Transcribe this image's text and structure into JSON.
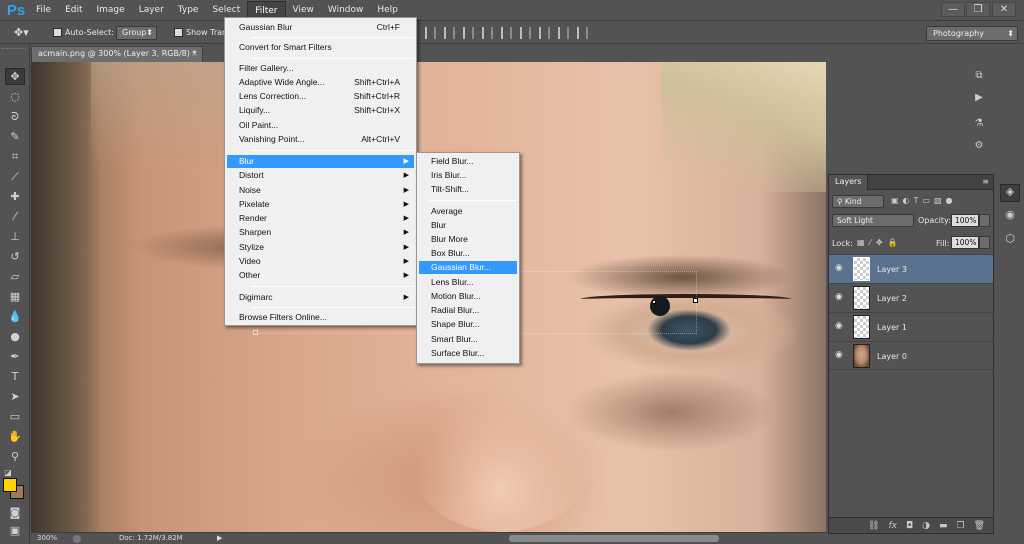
{
  "app": {
    "logo": "Ps"
  },
  "menubar": [
    "File",
    "Edit",
    "Image",
    "Layer",
    "Type",
    "Select",
    "Filter",
    "View",
    "Window",
    "Help"
  ],
  "window_controls": {
    "minimize": "—",
    "maximize": "❐",
    "close": "✕"
  },
  "options": {
    "auto_select_label": "Auto-Select:",
    "auto_select_value": "Group",
    "show_transform_label": "Show Tran"
  },
  "workspace": "Photography",
  "document": {
    "tab_title": "acmain.png @ 300% (Layer 3, RGB/8) *",
    "tab_close": "×"
  },
  "status": {
    "zoom": "300%",
    "doc_info": "Doc: 1.72M/3.82M",
    "arrow": "▶"
  },
  "filter_menu": {
    "items": [
      {
        "label": "Gaussian Blur",
        "shortcut": "Ctrl+F"
      },
      {
        "label": "Convert for Smart Filters",
        "shortcut": ""
      },
      {
        "label": "Filter Gallery...",
        "shortcut": ""
      },
      {
        "label": "Adaptive Wide Angle...",
        "shortcut": "Shift+Ctrl+A"
      },
      {
        "label": "Lens Correction...",
        "shortcut": "Shift+Ctrl+R"
      },
      {
        "label": "Liquify...",
        "shortcut": "Shift+Ctrl+X"
      },
      {
        "label": "Oil Paint...",
        "shortcut": ""
      },
      {
        "label": "Vanishing Point...",
        "shortcut": "Alt+Ctrl+V"
      },
      {
        "label": "Blur",
        "shortcut": ""
      },
      {
        "label": "Distort",
        "shortcut": ""
      },
      {
        "label": "Noise",
        "shortcut": ""
      },
      {
        "label": "Pixelate",
        "shortcut": ""
      },
      {
        "label": "Render",
        "shortcut": ""
      },
      {
        "label": "Sharpen",
        "shortcut": ""
      },
      {
        "label": "Stylize",
        "shortcut": ""
      },
      {
        "label": "Video",
        "shortcut": ""
      },
      {
        "label": "Other",
        "shortcut": ""
      },
      {
        "label": "Digimarc",
        "shortcut": ""
      },
      {
        "label": "Browse Filters Online...",
        "shortcut": ""
      }
    ],
    "submenu_arrow": "▶"
  },
  "blur_submenu": {
    "items": [
      "Field Blur...",
      "Iris Blur...",
      "Tilt-Shift...",
      "Average",
      "Blur",
      "Blur More",
      "Box Blur...",
      "Gaussian Blur...",
      "Lens Blur...",
      "Motion Blur...",
      "Radial Blur...",
      "Shape Blur...",
      "Smart Blur...",
      "Surface Blur..."
    ]
  },
  "layers_panel": {
    "tab": "Layers",
    "panel_menu": "≡",
    "kind_filter": "Kind",
    "blend_mode": "Soft Light",
    "opacity_label": "Opacity:",
    "opacity": "100%",
    "lock_label": "Lock:",
    "fill_label": "Fill:",
    "fill": "100%",
    "layers": [
      {
        "name": "Layer 3",
        "selected": true
      },
      {
        "name": "Layer 2",
        "selected": false
      },
      {
        "name": "Layer 1",
        "selected": false
      },
      {
        "name": "Layer 0",
        "selected": false
      }
    ],
    "footer_icons": [
      "link-icon",
      "fx-icon",
      "mask-icon",
      "adjustment-icon",
      "group-icon",
      "new-layer-icon",
      "trash-icon"
    ]
  },
  "colors": {
    "foreground": "#ffd200",
    "background": "#9c7a5a",
    "selection": "#3399ff",
    "layer_selected": "#5b7190"
  }
}
